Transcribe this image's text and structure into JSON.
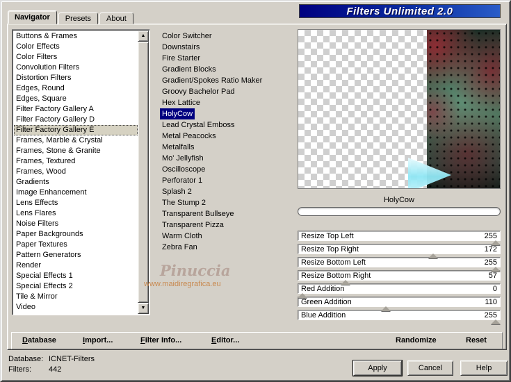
{
  "window": {
    "title": "Filters Unlimited 2.0",
    "tabs": [
      {
        "label": "Navigator",
        "active": true
      },
      {
        "label": "Presets",
        "active": false
      },
      {
        "label": "About",
        "active": false
      }
    ]
  },
  "categories": {
    "items": [
      "Buttons & Frames",
      "Color Effects",
      "Color Filters",
      "Convolution Filters",
      "Distortion Filters",
      "Edges, Round",
      "Edges, Square",
      "Filter Factory Gallery A",
      "Filter Factory Gallery D",
      "Filter Factory Gallery E",
      "Frames, Marble & Crystal",
      "Frames, Stone & Granite",
      "Frames, Textured",
      "Frames, Wood",
      "Gradients",
      "Image Enhancement",
      "Lens Effects",
      "Lens Flares",
      "Noise Filters",
      "Paper Backgrounds",
      "Paper Textures",
      "Pattern Generators",
      "Render",
      "Special Effects 1",
      "Special Effects 2",
      "Tile & Mirror",
      "Video"
    ],
    "selected": "Filter Factory Gallery E"
  },
  "filters": {
    "items": [
      "Color Switcher",
      "Downstairs",
      "Fire Starter",
      "Gradient Blocks",
      "Gradient/Spokes Ratio Maker",
      "Groovy Bachelor Pad",
      "Hex Lattice",
      "HolyCow",
      "Lead Crystal Emboss",
      "Metal Peacocks",
      "Metalfalls",
      "Mo' Jellyfish",
      "Oscilloscope",
      "Perforator 1",
      "Splash 2",
      "The Stump 2",
      "Transparent Bullseye",
      "Transparent Pizza",
      "Warm Cloth",
      "Zebra Fan"
    ],
    "selected": "HolyCow"
  },
  "watermark": {
    "line1": "Pinuccia",
    "line2": "www.maidiregrafica.eu"
  },
  "preview": {
    "filter_name": "HolyCow",
    "image": "metal-texture-with-cyan-arrow"
  },
  "parameters": [
    {
      "label": "Resize Top Left",
      "value": 255,
      "max": 255
    },
    {
      "label": "Resize Top Right",
      "value": 172,
      "max": 255
    },
    {
      "label": "Resize Bottom Left",
      "value": 255,
      "max": 255
    },
    {
      "label": "Resize Bottom Right",
      "value": 57,
      "max": 255
    },
    {
      "label": "Red Addition",
      "value": 0,
      "max": 255
    },
    {
      "label": "Green Addition",
      "value": 110,
      "max": 255
    },
    {
      "label": "Blue Addition",
      "value": 255,
      "max": 255
    }
  ],
  "toolbar": {
    "database": "Database",
    "import": "Import...",
    "filter_info": "Filter Info...",
    "editor": "Editor...",
    "randomize": "Randomize",
    "reset": "Reset"
  },
  "status": {
    "database_label": "Database:",
    "database_value": "ICNET-Filters",
    "filters_label": "Filters:",
    "filters_value": "442"
  },
  "actions": {
    "apply": "Apply",
    "cancel": "Cancel",
    "help": "Help"
  },
  "colors": {
    "selection": "#000080",
    "banner_start": "#000080",
    "banner_end": "#2a5cc8",
    "dialog": "#d4d0c8"
  }
}
